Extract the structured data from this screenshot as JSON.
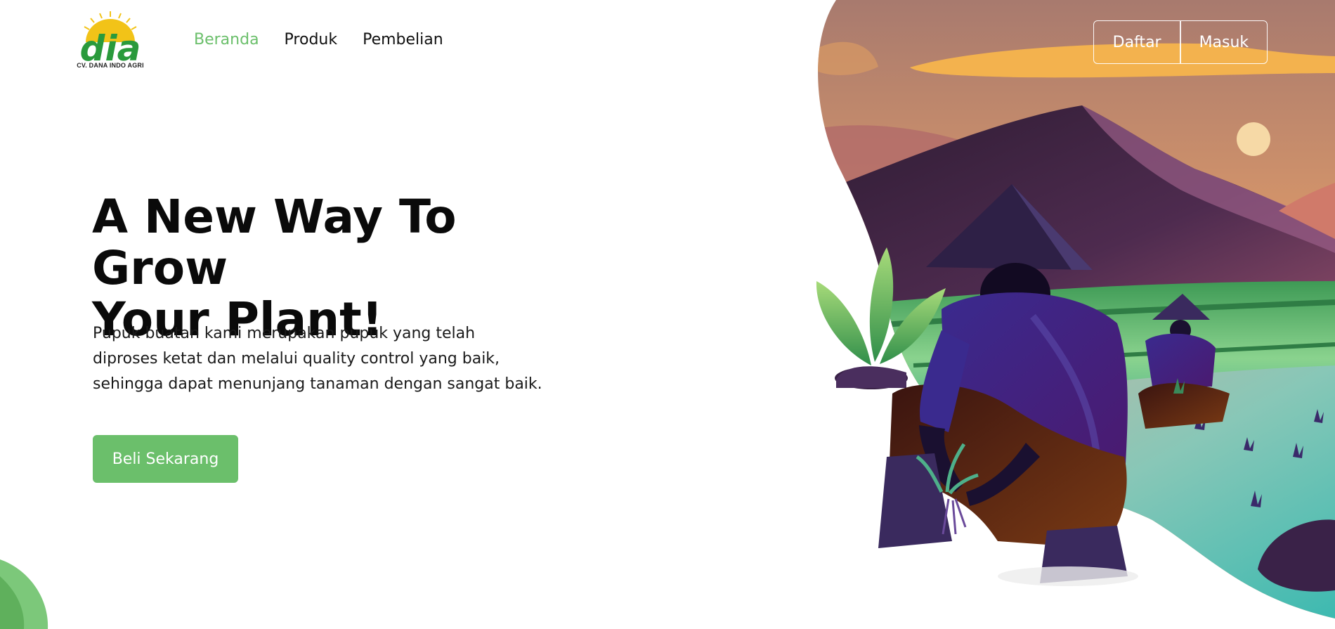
{
  "brand": {
    "logo_text": "dia",
    "company": "CV. DANA INDO AGRI"
  },
  "nav": {
    "items": [
      {
        "label": "Beranda",
        "active": true
      },
      {
        "label": "Produk",
        "active": false
      },
      {
        "label": "Pembelian",
        "active": false
      }
    ]
  },
  "auth": {
    "register_label": "Daftar",
    "login_label": "Masuk"
  },
  "hero": {
    "headline_line1": "A New Way To Grow",
    "headline_line2": "Your Plant!",
    "description_line1": "Pupuk buatan kami merupakan pupuk yang telah",
    "description_line2": "diproses ketat dan melalui quality control yang baik,",
    "description_line3": "sehingga dapat menunjang tanaman dengan sangat baik.",
    "cta_label": "Beli Sekarang",
    "illustration": "rice-farmers-planting-at-sunset"
  },
  "colors": {
    "accent": "#6bbf6b",
    "text": "#0a0a0a",
    "logo_green": "#2a9a3c",
    "logo_sun": "#f2c318"
  }
}
